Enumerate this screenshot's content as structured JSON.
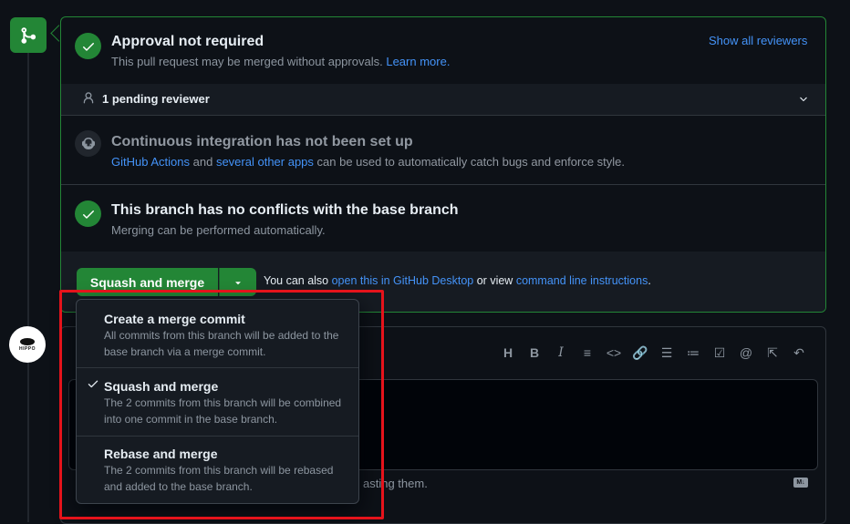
{
  "approval": {
    "title": "Approval not required",
    "desc": "This pull request may be merged without approvals.",
    "learn_more": "Learn more.",
    "show_reviewers": "Show all reviewers"
  },
  "pending": {
    "label": "1 pending reviewer"
  },
  "ci": {
    "title": "Continuous integration has not been set up",
    "link1": "GitHub Actions",
    "mid": "and",
    "link2": "several other apps",
    "rest": "can be used to automatically catch bugs and enforce style."
  },
  "conflicts": {
    "title": "This branch has no conflicts with the base branch",
    "desc": "Merging can be performed automatically."
  },
  "merge": {
    "button_label": "Squash and merge",
    "also_text": "You can also",
    "desktop_link": "open this in GitHub Desktop",
    "or_view": "or view",
    "cli_link": "command line instructions",
    "period": "."
  },
  "dropdown": {
    "items": [
      {
        "title": "Create a merge commit",
        "desc": "All commits from this branch will be added to the base branch via a merge commit.",
        "selected": false
      },
      {
        "title": "Squash and merge",
        "desc": "The 2 commits from this branch will be combined into one commit in the base branch.",
        "selected": true
      },
      {
        "title": "Rebase and merge",
        "desc": "The 2 commits from this branch will be rebased and added to the base branch.",
        "selected": false
      }
    ]
  },
  "comment": {
    "partial_hint": "asting them.",
    "avatar_text": "HIPPO"
  },
  "colors": {
    "success": "#238636",
    "link": "#4493f8",
    "highlight": "#e5131b"
  }
}
